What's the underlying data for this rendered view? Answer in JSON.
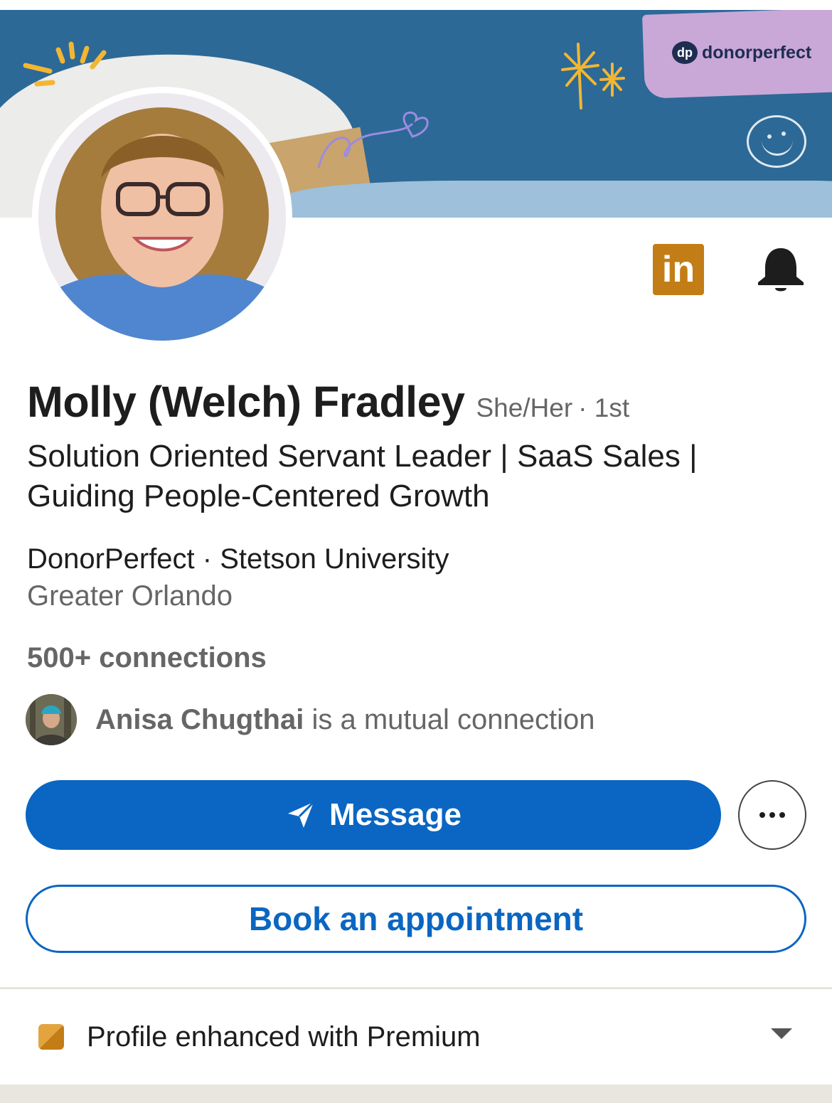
{
  "banner": {
    "brand_mark": "dp",
    "brand_name": "donorperfect"
  },
  "profile": {
    "name": "Molly (Welch) Fradley",
    "pronouns": "She/Her",
    "degree": "· 1st",
    "headline": "Solution Oriented Servant Leader | SaaS Sales | Guiding People-Centered Growth",
    "orgs": "DonorPerfect · Stetson University",
    "location": "Greater Orlando",
    "connections": "500+ connections",
    "linkedin_badge": "in"
  },
  "mutual": {
    "name": "Anisa Chugthai",
    "suffix": " is a mutual connection"
  },
  "actions": {
    "message_label": "Message",
    "book_label": "Book an appointment"
  },
  "premium": {
    "label": "Profile enhanced with Premium"
  },
  "colors": {
    "brand_blue": "#0a66c2",
    "premium_gold": "#c37d16"
  },
  "icons": [
    "linkedin-logo-icon",
    "bell-icon",
    "send-icon",
    "more-icon",
    "premium-icon",
    "chevron-down-icon"
  ]
}
